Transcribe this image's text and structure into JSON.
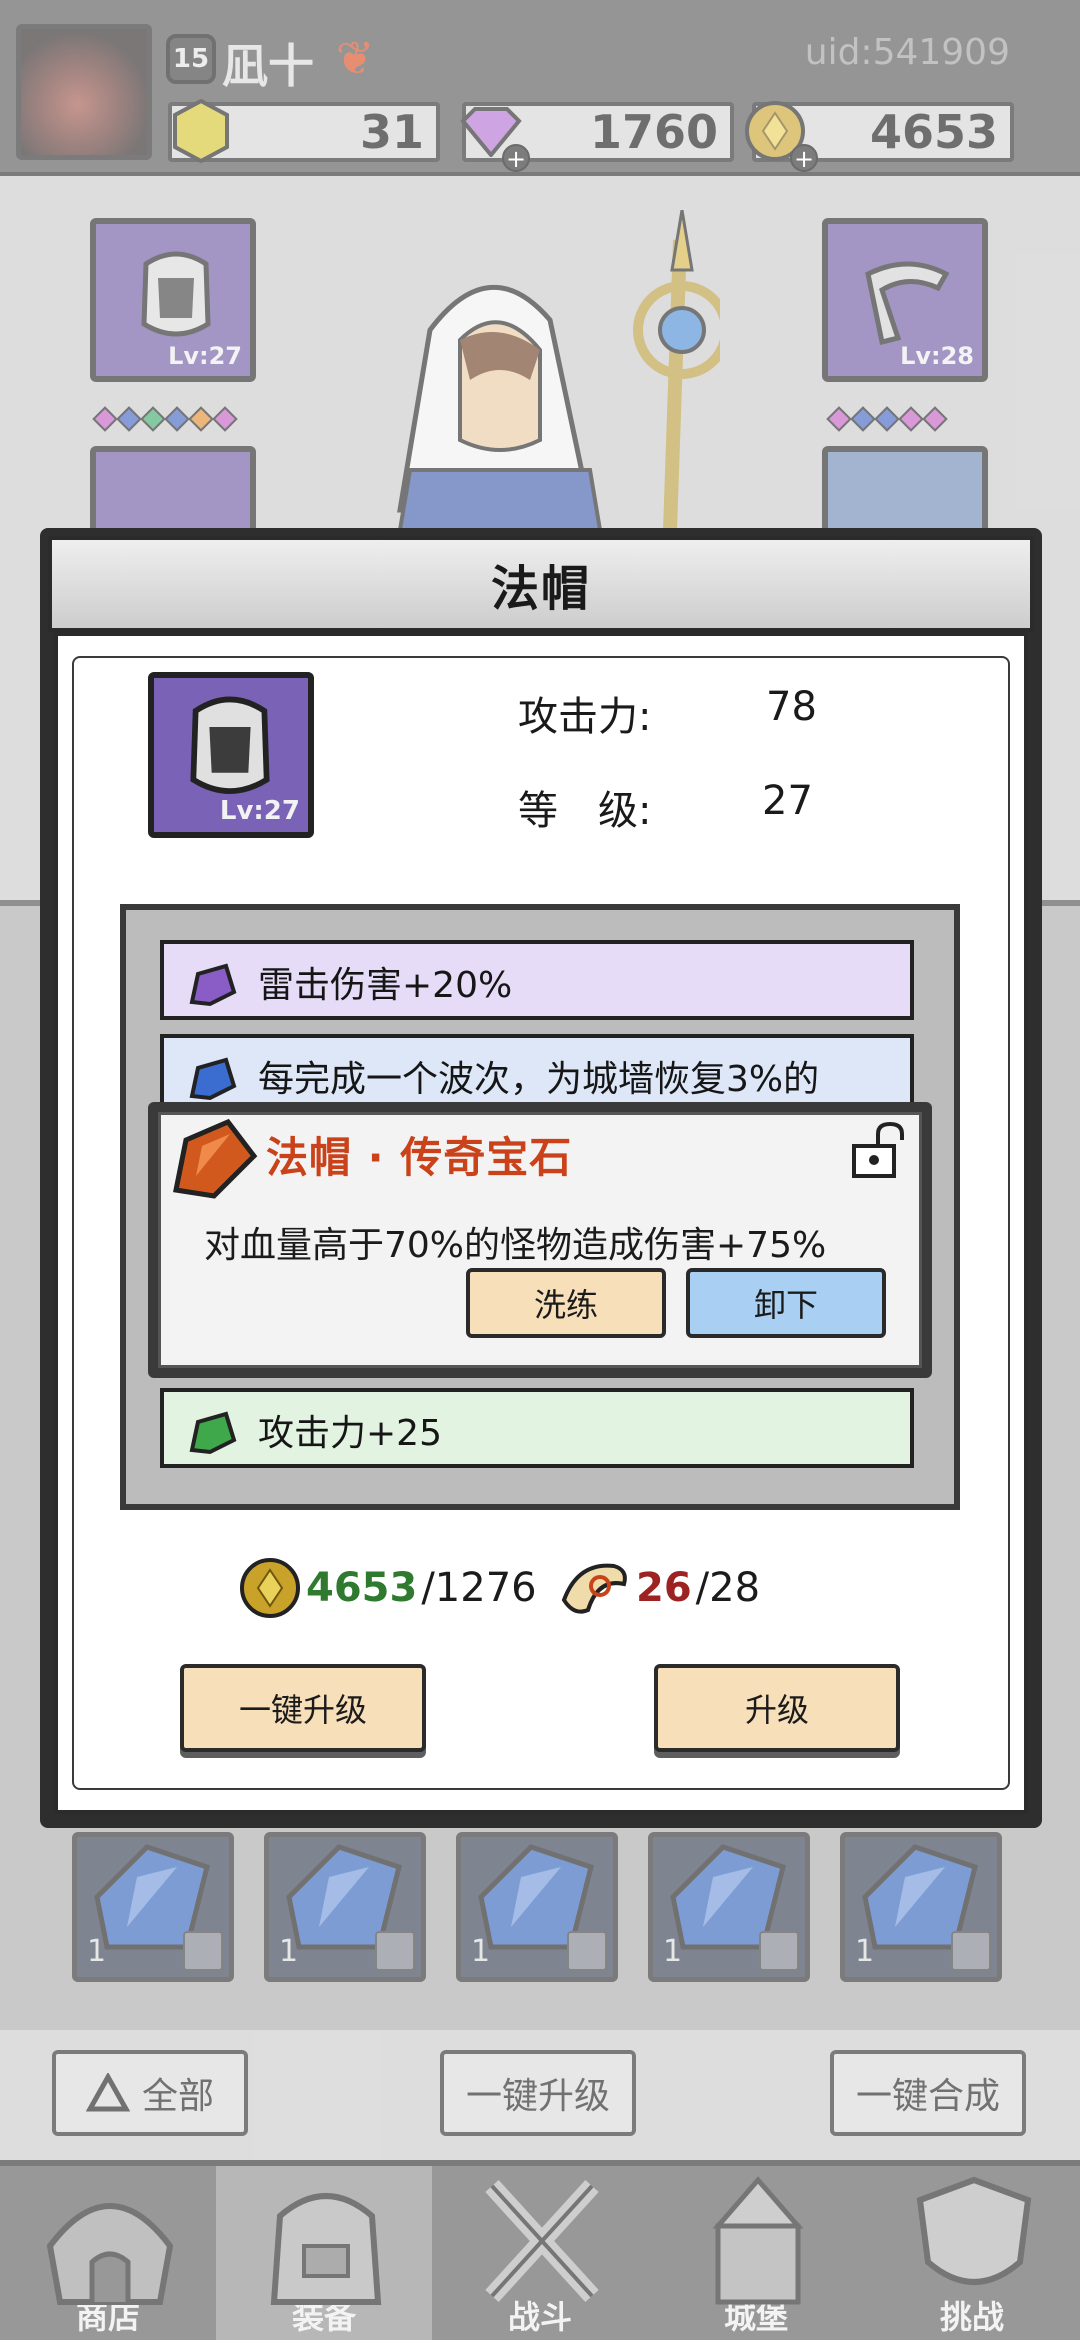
{
  "header": {
    "level": "15",
    "name": "凪十",
    "uid": "uid:541909",
    "resources": [
      {
        "icon": "yellow-gem-icon",
        "value": "31"
      },
      {
        "icon": "purple-diamond-icon",
        "value": "1760"
      },
      {
        "icon": "gold-coin-icon",
        "value": "4653"
      }
    ]
  },
  "equipment": {
    "left_top_level": "Lv:27",
    "right_top_level": "Lv:28"
  },
  "inventory": {
    "quantities": [
      "1",
      "1",
      "1",
      "1",
      "1"
    ]
  },
  "toolbar": {
    "filter_label": "全部",
    "upgrade_all_label": "一键升级",
    "combine_all_label": "一键合成"
  },
  "nav": {
    "tabs": [
      {
        "label": "商店"
      },
      {
        "label": "装备"
      },
      {
        "label": "战斗"
      },
      {
        "label": "城堡"
      },
      {
        "label": "挑战"
      }
    ],
    "active": "装备"
  },
  "modal": {
    "title": "法帽",
    "item_level": "Lv:27",
    "attack_label": "攻击力:",
    "attack_value": "78",
    "level_label": "等　级:",
    "level_value": "27",
    "gems": [
      {
        "text": "雷击伤害+20%",
        "color": "#e6dcf7"
      },
      {
        "text": "每完成一个波次，为城墙恢复3%的",
        "color": "#dde7f7"
      },
      {
        "text": "攻击力+25",
        "color": "#e2f3e2"
      }
    ],
    "popup": {
      "title": "法帽 · 传奇宝石",
      "desc": "对血量高于70%的怪物造成伤害+75%",
      "reroll_label": "洗练",
      "remove_label": "卸下"
    },
    "costs": {
      "gold_have": "4653",
      "gold_need": "/1276",
      "scroll_have": "26",
      "scroll_need": "/28"
    },
    "buttons": {
      "upgrade_all": "一键升级",
      "upgrade": "升级"
    }
  },
  "colors": {
    "legendary": "#c9421a",
    "reroll_btn": "#f7dfba",
    "remove_btn": "#a9d0f3"
  }
}
